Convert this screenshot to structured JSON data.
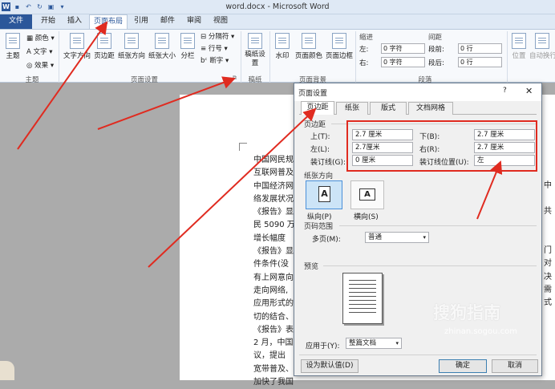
{
  "window": {
    "title": "word.docx - Microsoft Word"
  },
  "quick_access": [
    "W",
    "save",
    "undo",
    "redo",
    "print",
    "customize"
  ],
  "tabs": [
    "文件",
    "开始",
    "插入",
    "页面布局",
    "引用",
    "邮件",
    "审阅",
    "视图"
  ],
  "ribbon": {
    "theme": {
      "btn_main": "主题",
      "colors": "颜色",
      "fonts": "文字",
      "effects": "效果",
      "group": "主题"
    },
    "page_setup": {
      "text_dir": "文字方向",
      "margins": "页边距",
      "orientation": "纸张方向",
      "size": "纸张大小",
      "columns": "分栏",
      "breaks": "分隔符",
      "line_numbers": "行号",
      "hyphenation": "断字",
      "group": "页面设置"
    },
    "draft": {
      "btn": "稿纸设置",
      "group": "稿纸"
    },
    "background": {
      "watermark": "水印",
      "page_color": "页面颜色",
      "page_border": "页面边框",
      "group": "页面背景"
    },
    "paragraph": {
      "indent_label": "缩进",
      "spacing_label": "间距",
      "left": "左:",
      "left_val": "0 字符",
      "right": "右:",
      "right_val": "0 字符",
      "before": "段前:",
      "before_val": "0 行",
      "after": "段后:",
      "after_val": "0 行",
      "group": "段落"
    },
    "arrange": {
      "position": "位置",
      "wrap": "自动换行"
    }
  },
  "document": {
    "lines": [
      "中国网民规模",
      "互联网普及",
      "中国经济网",
      "络发展状况",
      "《报告》显",
      "民 5090 万",
      "增长幅度",
      "《报告》显",
      "件条件(没",
      "有上网意向",
      "走向网络,",
      "应用形式的",
      "切的结合、",
      "《报告》表",
      "2 月，中国",
      "议，提出",
      "宽带普及、",
      "加快了我国"
    ],
    "right_chars": [
      "中",
      "共",
      "门",
      "对",
      "决",
      "需",
      "式"
    ]
  },
  "dialog": {
    "title": "页面设置",
    "help": "?",
    "close": "✕",
    "tabs": [
      "页边距",
      "纸张",
      "版式",
      "文档网格"
    ],
    "margins_section": "页边距",
    "top_label": "上(T):",
    "top_val": "2.7 厘米",
    "bottom_label": "下(B):",
    "bottom_val": "2.7 厘米",
    "left_label": "左(L):",
    "left_val": "2.7厘米",
    "right_label": "右(R):",
    "right_val": "2.7 厘米",
    "gutter_label": "装订线(G):",
    "gutter_val": "0 厘米",
    "gutter_pos_label": "装订线位置(U):",
    "gutter_pos_val": "左",
    "orientation_section": "纸张方向",
    "portrait": "纵向(P)",
    "landscape": "横向(S)",
    "orientation_letter": "A",
    "pages_section": "页码范围",
    "multiple_label": "多页(M):",
    "multiple_val": "普通",
    "preview_section": "预览",
    "apply_label": "应用于(Y):",
    "apply_val": "整篇文档",
    "default_btn": "设为默认值(D)",
    "ok_btn": "确定",
    "cancel_btn": "取消"
  },
  "watermark": {
    "text": "搜狗指南",
    "sub": "zhinan.sogou.com"
  },
  "annotations": {
    "arrow_color": "#e02b20",
    "box_color": "#e02b20"
  }
}
